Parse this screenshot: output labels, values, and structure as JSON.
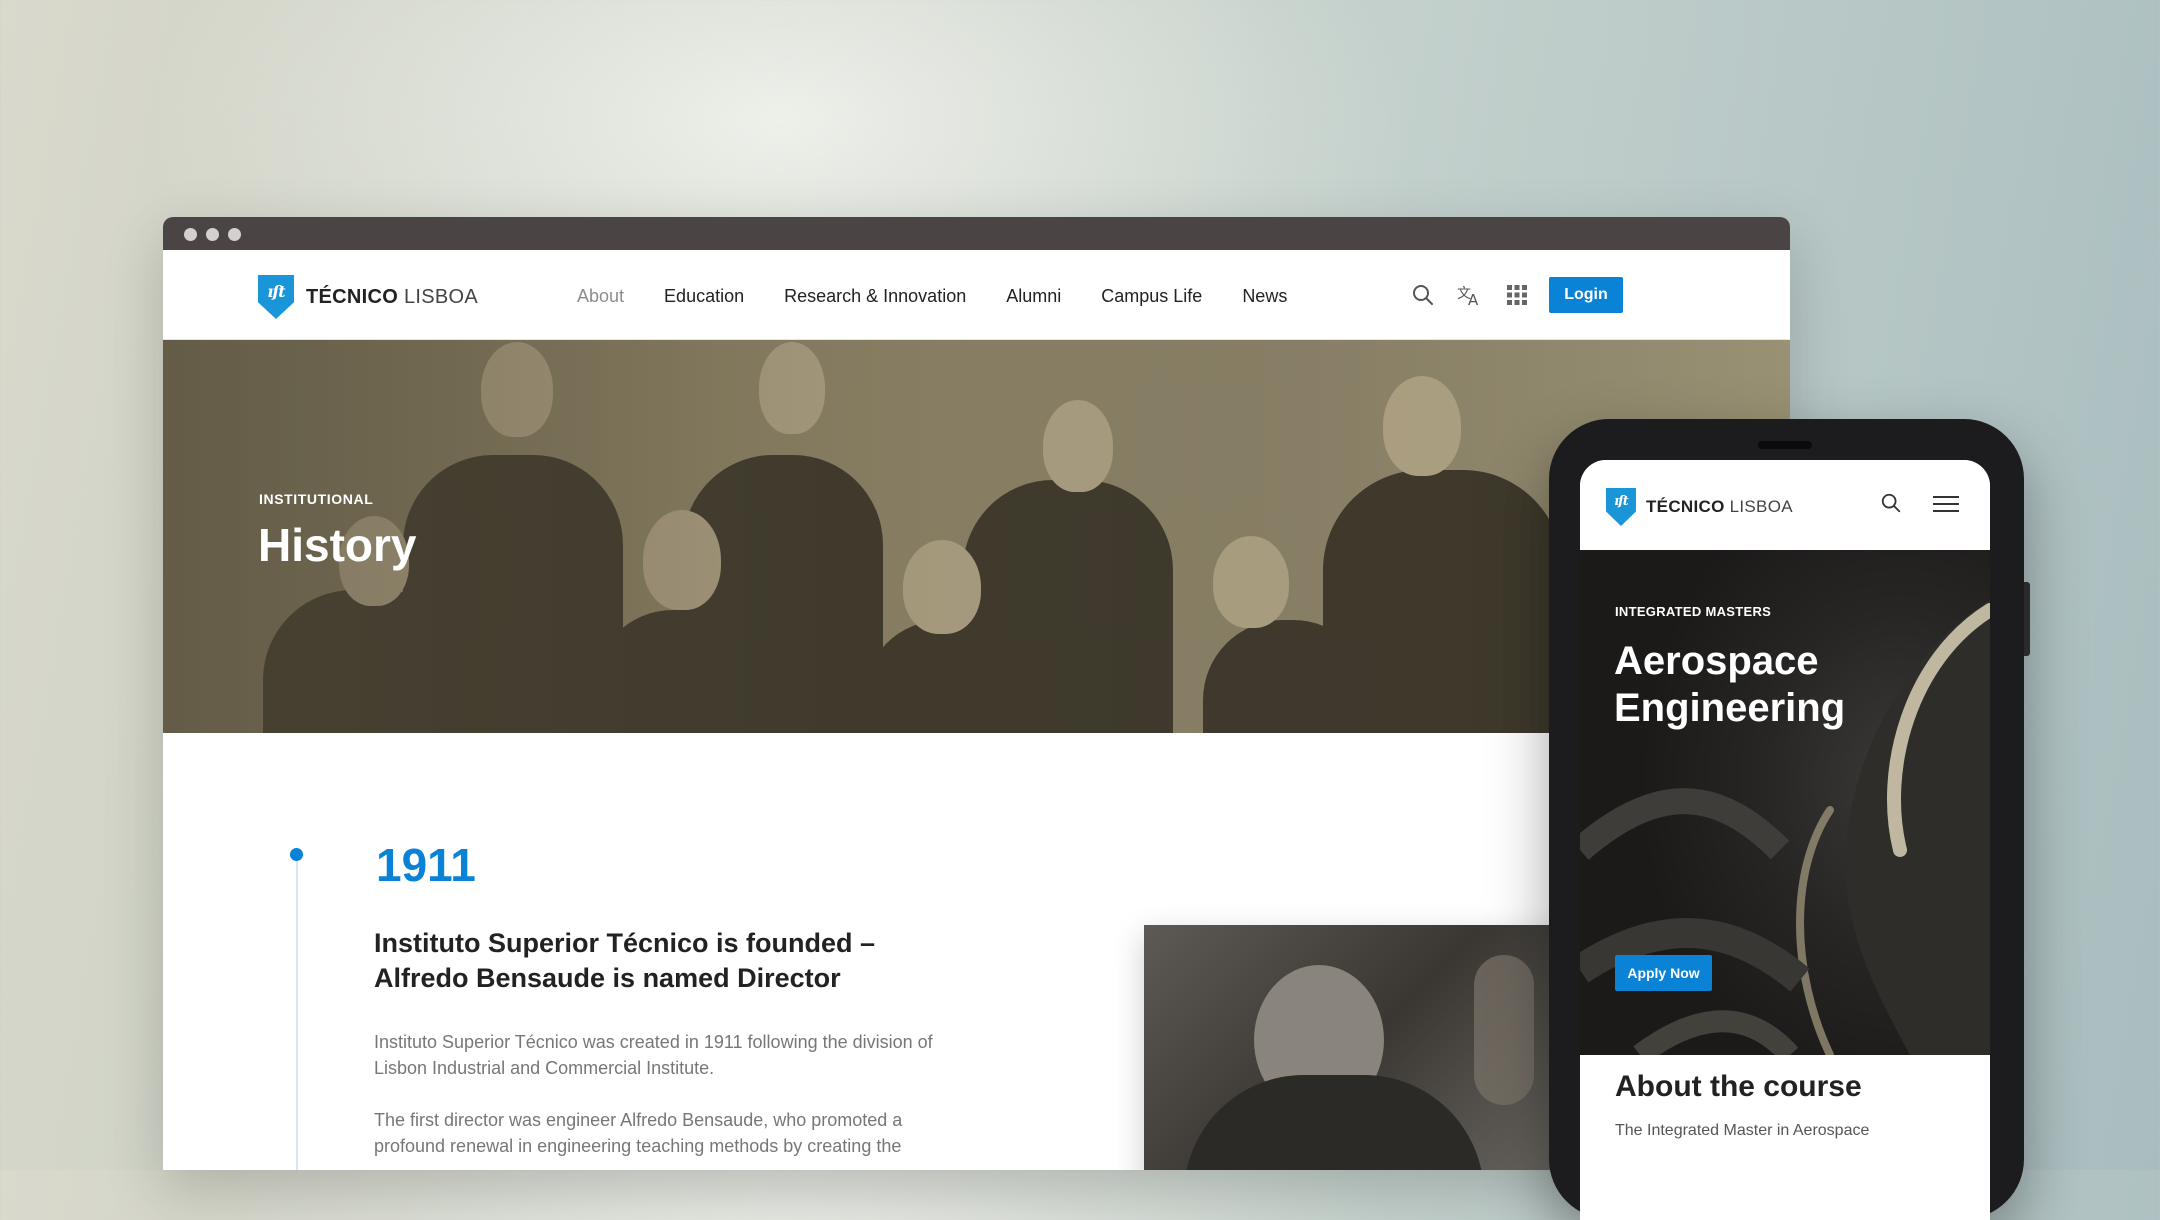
{
  "desktop": {
    "logo": {
      "brand_bold": "TÉCNICO",
      "brand_light": "LISBOA",
      "mark": "ıſt"
    },
    "nav": [
      "About",
      "Education",
      "Research & Innovation",
      "Alumni",
      "Campus Life",
      "News"
    ],
    "icons": [
      "search-icon",
      "translate-icon",
      "apps-grid-icon"
    ],
    "login_label": "Login",
    "hero": {
      "eyebrow": "INSTITUTIONAL",
      "title": "History"
    },
    "timeline": {
      "year": "1911",
      "heading": "Instituto Superior Técnico is founded – Alfredo Bensaude is named Director",
      "paragraph1": "Instituto Superior Técnico was created in 1911 following the division of Lisbon Industrial and Commercial Institute.",
      "paragraph2": "The first director was engineer Alfredo Bensaude, who promoted a profound renewal in engineering teaching methods by creating the"
    }
  },
  "mobile": {
    "logo": {
      "brand_bold": "TÉCNICO",
      "brand_light": "LISBOA",
      "mark": "ıſt"
    },
    "hero": {
      "eyebrow": "INTEGRATED MASTERS",
      "title_line1": "Aerospace",
      "title_line2": "Engineering"
    },
    "apply_label": "Apply Now",
    "about_heading": "About the course",
    "about_text": "The Integrated Master in Aerospace"
  },
  "colors": {
    "accent": "#0a82d6",
    "logo_blue": "#1a95d8",
    "titlebar": "#4a4444"
  }
}
